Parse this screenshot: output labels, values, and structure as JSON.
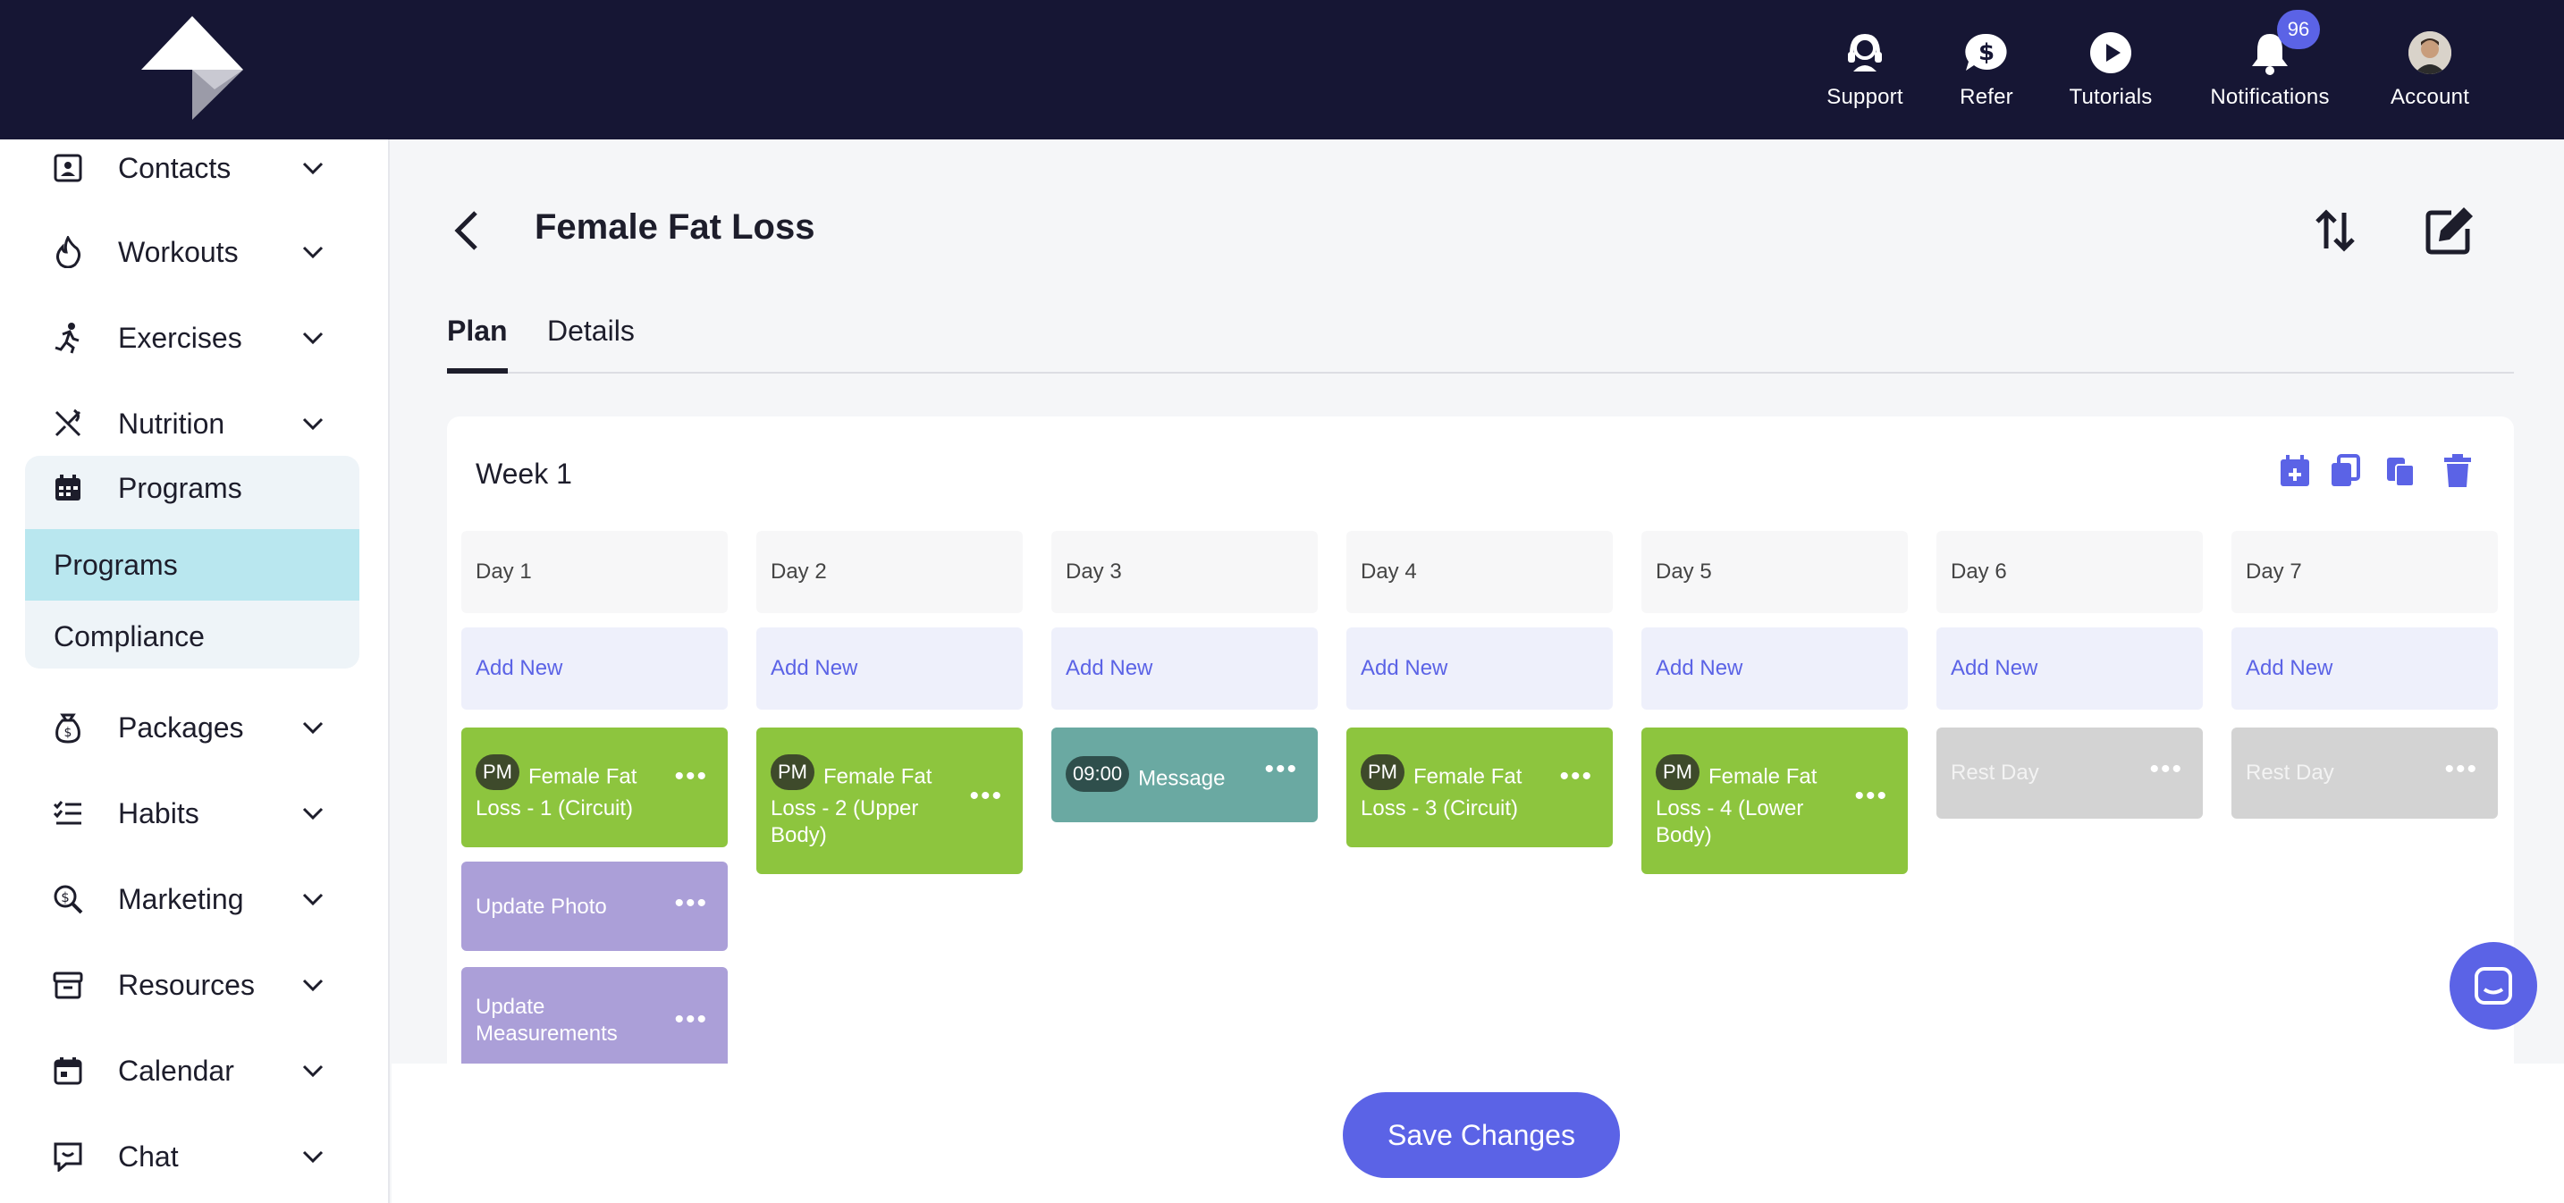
{
  "topnav": {
    "items": [
      {
        "label": "Support",
        "icon": "support-headset-icon"
      },
      {
        "label": "Refer",
        "icon": "dollar-chat-icon"
      },
      {
        "label": "Tutorials",
        "icon": "play-circle-icon"
      },
      {
        "label": "Notifications",
        "icon": "bell-icon",
        "badge": "96"
      },
      {
        "label": "Account",
        "icon": "avatar"
      }
    ]
  },
  "sidebar": {
    "items": [
      {
        "label": "Contacts",
        "icon": "contact-card-icon"
      },
      {
        "label": "Workouts",
        "icon": "flame-icon"
      },
      {
        "label": "Exercises",
        "icon": "running-person-icon"
      },
      {
        "label": "Nutrition",
        "icon": "fork-knife-icon"
      },
      {
        "label": "Programs",
        "icon": "calendar-grid-icon"
      },
      {
        "label": "Packages",
        "icon": "money-bag-icon"
      },
      {
        "label": "Habits",
        "icon": "checklist-icon"
      },
      {
        "label": "Marketing",
        "icon": "search-dollar-icon"
      },
      {
        "label": "Resources",
        "icon": "archive-box-icon"
      },
      {
        "label": "Calendar",
        "icon": "calendar-icon"
      },
      {
        "label": "Chat",
        "icon": "chat-bubble-icon"
      }
    ],
    "programs_sub": [
      "Programs",
      "Compliance"
    ]
  },
  "page": {
    "title": "Female Fat Loss",
    "tabs": [
      "Plan",
      "Details"
    ],
    "active_tab": "Plan"
  },
  "plan": {
    "week_label": "Week 1",
    "add_new_label": "Add New",
    "days": [
      {
        "label": "Day 1",
        "items": [
          {
            "type": "green",
            "pill": "PM",
            "text": "Female Fat Loss - 1 (Circuit)"
          },
          {
            "type": "purple",
            "text": "Update Photo"
          },
          {
            "type": "purple",
            "text": "Update Measurements"
          }
        ]
      },
      {
        "label": "Day 2",
        "items": [
          {
            "type": "green",
            "pill": "PM",
            "text": "Female Fat Loss - 2 (Upper Body)"
          }
        ]
      },
      {
        "label": "Day 3",
        "items": [
          {
            "type": "teal",
            "pill": "09:00",
            "text": "Message"
          }
        ]
      },
      {
        "label": "Day 4",
        "items": [
          {
            "type": "green",
            "pill": "PM",
            "text": "Female Fat Loss - 3 (Circuit)"
          }
        ]
      },
      {
        "label": "Day 5",
        "items": [
          {
            "type": "green",
            "pill": "PM",
            "text": "Female Fat Loss - 4 (Lower Body)"
          }
        ]
      },
      {
        "label": "Day 6",
        "items": [
          {
            "type": "gray",
            "text": "Rest Day"
          }
        ]
      },
      {
        "label": "Day 7",
        "items": [
          {
            "type": "gray",
            "text": "Rest Day"
          }
        ]
      }
    ]
  },
  "footer": {
    "save_label": "Save Changes"
  },
  "colors": {
    "topbar": "#161634",
    "accent": "#5b63e6",
    "workout_green": "#8dc53e",
    "message_teal": "#6aa9a2",
    "task_purple": "#ab9fd8",
    "rest_gray": "#d3d3d3",
    "active_sub": "#b9e7ef"
  }
}
